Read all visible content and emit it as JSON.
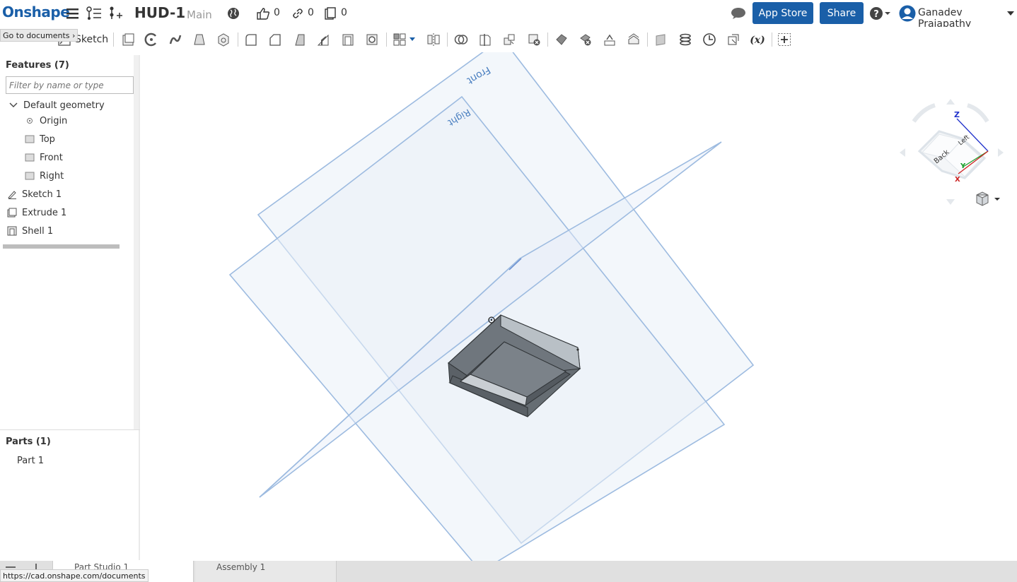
{
  "topbar": {
    "logo": "Onshape",
    "doc_title": "HUD-1",
    "branch": "Main",
    "likes": "0",
    "links": "0",
    "copies": "0",
    "app_store": "App Store",
    "share": "Share",
    "user": "Ganadev Prajapathy"
  },
  "tooltip": "Go to documents",
  "toolbar": {
    "sketch_label": "Sketch"
  },
  "features": {
    "header": "Features (7)",
    "filter_placeholder": "Filter by name or type",
    "default_geometry": "Default geometry",
    "origin": "Origin",
    "top": "Top",
    "front": "Front",
    "right": "Right",
    "items": [
      "Sketch 1",
      "Extrude 1",
      "Shell 1"
    ]
  },
  "parts": {
    "header": "Parts (1)",
    "items": [
      "Part 1"
    ]
  },
  "viewport": {
    "plane_front": "Front",
    "plane_right": "Right"
  },
  "viewcube": {
    "z": "Z",
    "y": "Y",
    "x": "X",
    "back": "Back",
    "left": "Left"
  },
  "tabs": {
    "part_studio": "Part Studio 1",
    "assembly": "Assembly 1"
  },
  "status_url": "https://cad.onshape.com/documents",
  "colors": {
    "brand": "#1a5fa8",
    "plane_stroke": "#9dbbe0",
    "plane_fill": "#e9f0f8",
    "part": "#6f767d"
  }
}
